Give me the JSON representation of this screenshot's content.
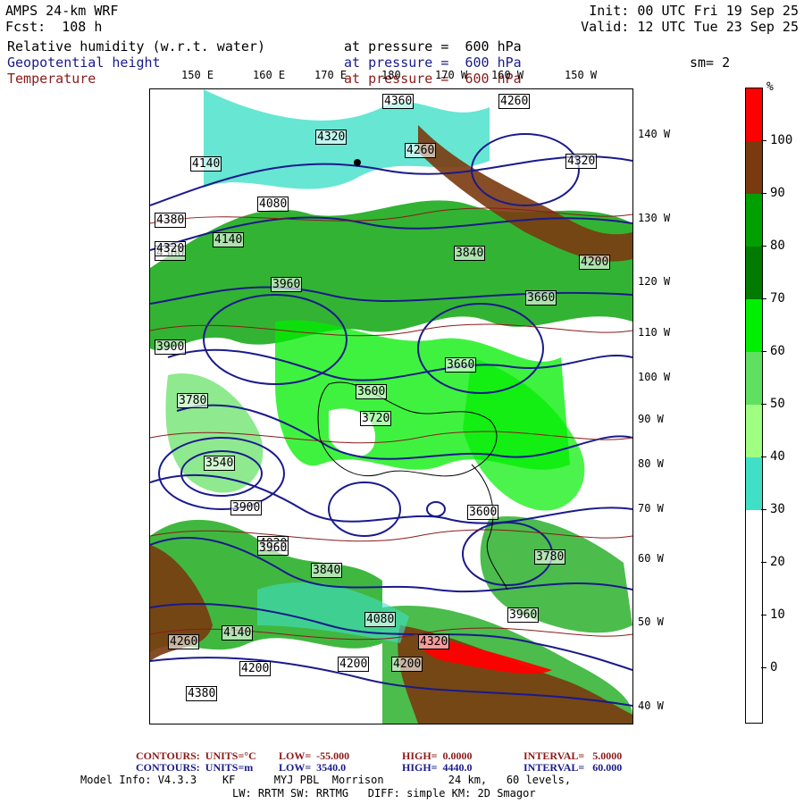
{
  "header": {
    "model": "AMPS 24-km WRF",
    "fcst": "Fcst:  108 h",
    "init": "Init: 00 UTC Fri 19 Sep 25",
    "valid": "Valid: 12 UTC Tue 23 Sep 25",
    "fields": [
      {
        "name": "Relative humidity (w.r.t. water)",
        "level": "at pressure =  600 hPa",
        "color": "#000000"
      },
      {
        "name": "Geopotential height",
        "level": "at pressure =  600 hPa",
        "color": "#1a1a8c"
      },
      {
        "name": "Temperature",
        "level": "at pressure =  600 hPa",
        "color": "#8b1a1a"
      }
    ],
    "sm": "sm= 2"
  },
  "longitude_labels": [
    "150 E",
    "160 E",
    "170 E",
    "180",
    "170 W",
    "160 W",
    "150 W"
  ],
  "latitude_labels": [
    "140 W",
    "130 W",
    "120 W",
    "110 W",
    "100 W",
    "90 W",
    "80 W",
    "70 W",
    "60 W",
    "50 W",
    "40 W"
  ],
  "height_contour_labels": [
    "4360",
    "4260",
    "4320",
    "4260",
    "4140",
    "4320",
    "4380",
    "4080",
    "4380",
    "4320",
    "4140",
    "4200",
    "3960",
    "3840",
    "3780",
    "3540",
    "3660",
    "3600",
    "3720",
    "3900",
    "3900",
    "4020",
    "3960",
    "3840",
    "3780",
    "3960",
    "4080",
    "4140",
    "4260",
    "4200",
    "4380",
    "4200",
    "4320",
    "4200",
    "3600",
    "3660"
  ],
  "colorbar": {
    "unit": "%",
    "levels": [
      "100",
      "90",
      "80",
      "70",
      "60",
      "50",
      "40",
      "30",
      "20",
      "10",
      "0"
    ],
    "colors": {
      "lt_0": "#ffffff",
      "0_10": "#ffffff",
      "10_20": "#ffffff",
      "20_30": "#ffffff",
      "30_40": "#40e0c8",
      "40_50": "#a0ff80",
      "50_60": "#60e060",
      "60_70": "#00ee00",
      "70_80": "#007a00",
      "80_90": "#00a000",
      "90_100": "#7a3a10",
      "gt_100": "#ff0000"
    }
  },
  "footer": {
    "contour1": {
      "units": "CONTOURS:  UNITS=°C",
      "low": "LOW=  -55.000",
      "high": "HIGH=  0.0000",
      "interval": "INTERVAL=   5.0000",
      "color": "#8b1a1a"
    },
    "contour2": {
      "units": "CONTOURS:  UNITS=m",
      "low": "LOW=  3540.0",
      "high": "HIGH=  4440.0",
      "interval": "INTERVAL=   60.000",
      "color": "#1a1a8c"
    },
    "model_info_1": "Model Info: V4.3.3    KF      MYJ PBL  Morrison          24 km,   60 levels,",
    "model_info_2": "LW: RRTM SW: RRTMG   DIFF: simple KM: 2D Smagor"
  }
}
